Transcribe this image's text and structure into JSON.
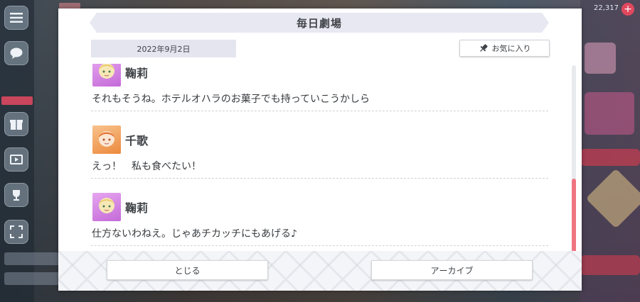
{
  "dialog": {
    "title": "毎日劇場",
    "date": "2022年9月2日",
    "favorite_label": "お気に入り",
    "close_label": "とじる",
    "archive_label": "アーカイブ"
  },
  "log": [
    {
      "speaker": "鞠莉",
      "avatar_color": "purple",
      "text": "それもそうね。ホテルオハラのお菓子でも持っていこうかしら"
    },
    {
      "speaker": "千歌",
      "avatar_color": "orange",
      "text": "えっ！　私も食べたい！"
    },
    {
      "speaker": "鞠莉",
      "avatar_color": "purple",
      "text": "仕方ないわねえ。じゃあチカッチにもあげる♪"
    }
  ],
  "background": {
    "counter": "22,317",
    "icons": [
      "menu-icon",
      "chat-icon",
      "gift-icon",
      "video-icon",
      "trophy-icon",
      "fullscreen-icon"
    ]
  },
  "colors": {
    "scroll_thumb": "#ef7580",
    "banner": "#e7e8f1",
    "accent_pink": "#e0485e"
  }
}
